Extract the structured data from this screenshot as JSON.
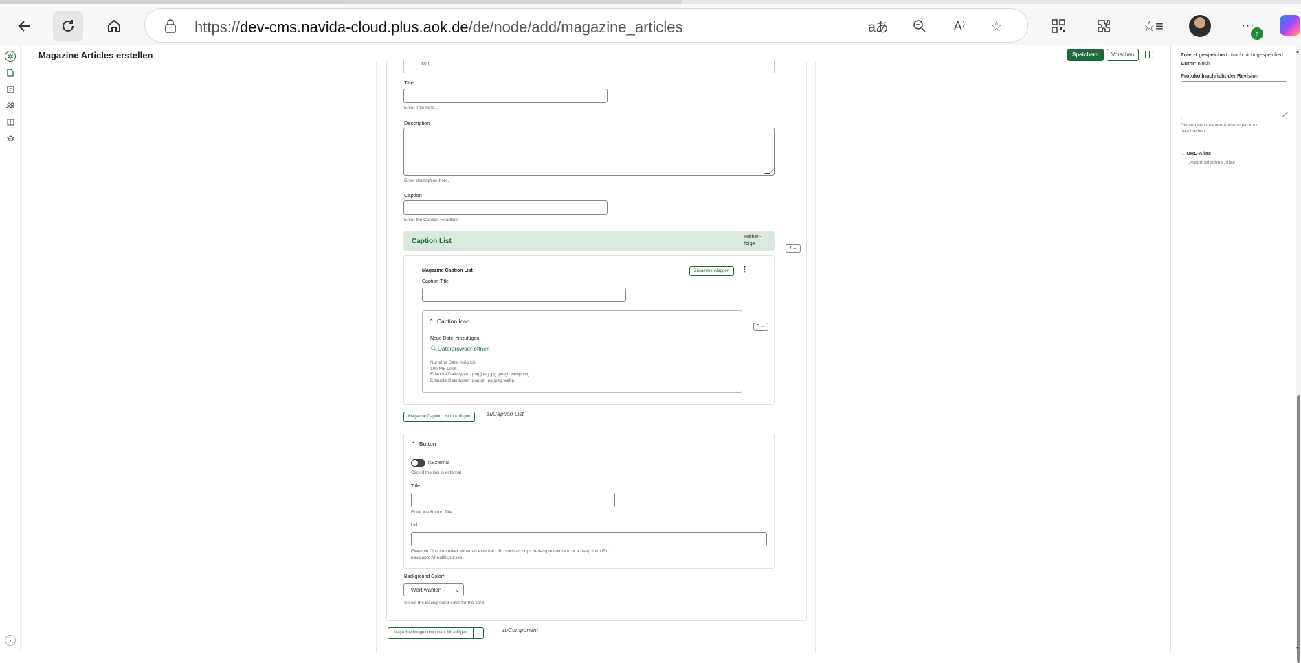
{
  "browser": {
    "url_prefix": "https://",
    "url_domain": "dev-cms.navida-cloud.plus.aok.de",
    "url_path": "/de/node/add/magazine_articles",
    "icons": [
      "back-icon",
      "refresh-icon",
      "home-icon",
      "lock-icon",
      "translate-icon",
      "zoom-out-icon",
      "read-aloud-icon",
      "favorite-star-icon",
      "qr-code-icon",
      "extensions-icon",
      "favorites-list-icon",
      "profile-avatar",
      "more-icon",
      "copilot-icon"
    ],
    "more_label": "···"
  },
  "header": {
    "title": "Magazine Articles erstellen",
    "save_label": "Speichern",
    "preview_label": "Vorschau"
  },
  "sidebar": {
    "icons": [
      "aok-logo-icon",
      "document-icon",
      "media-icon",
      "users-icon",
      "layout-icon",
      "layers-icon"
    ]
  },
  "form": {
    "top_field_partial": "Icon",
    "title_label": "Title",
    "title_hint": "Enter Title here.",
    "description_label": "Description",
    "description_hint": "Enter description here.",
    "caption_label": "Caption",
    "caption_hint": "Enter the Caption Headline",
    "caption_list": {
      "heading": "Caption List",
      "order_label_1": "Reihen-",
      "order_label_2": "folge",
      "order_value": "4",
      "item_title": "Magazine Caption List",
      "collapse_label": "Zusammenklappen",
      "caption_title_label": "Caption Title",
      "icon_section": {
        "heading": "Caption Icon",
        "weight_value": "0",
        "add_file_label": "Neue Datei hinzufügen",
        "browse_label": "Dateibrowser öffnen",
        "rules": [
          "Nur eine Datei möglich.",
          "100 MB Limit.",
          "Erlaubte Dateitypen: png jpeg jpg jpe gif webp svg.",
          "Erlaubte Dateitypen: png gif jpg jpeg webp."
        ]
      },
      "add_button_label": "Magazine Caption List hinzufügen",
      "add_to_prefix": "zu",
      "add_to_target": "Caption List"
    },
    "button_section": {
      "heading": "Button",
      "isexternal_label": "isExternal",
      "isexternal_hint": "Click if the link is external",
      "title_label": "Title",
      "title_hint": "Enter the Button Title",
      "url_label": "Url",
      "url_hint_1": "Example: You can enter either an external URL such as https://example.com/abc or a deep link URL:",
      "url_hint_2": "navidapro://healthcourses"
    },
    "background_color": {
      "label": "Background Color",
      "required_mark": "*",
      "select_value": "- Wert wählen -",
      "hint": "Select the Background color for the card"
    },
    "add_component_label": "Magazine Image component hinzufügen",
    "add_component_prefix": "zu",
    "add_component_target": "Component"
  },
  "right_panel": {
    "last_saved_label": "Zuletzt gespeichert:",
    "last_saved_value": "Noch nicht gespeichert",
    "author_label": "Autor:",
    "author_value": "nitish",
    "revision_label": "Protokollnachricht der Revision",
    "revision_hint_1": "Die vorgenommenen Änderungen kurz",
    "revision_hint_2": "beschreiben.",
    "url_alias_label": "URL-Alias",
    "url_alias_value": "Automatisches Alias"
  },
  "colors": {
    "accent": "#1d6b3a",
    "section_bg": "#dbe8dd"
  }
}
